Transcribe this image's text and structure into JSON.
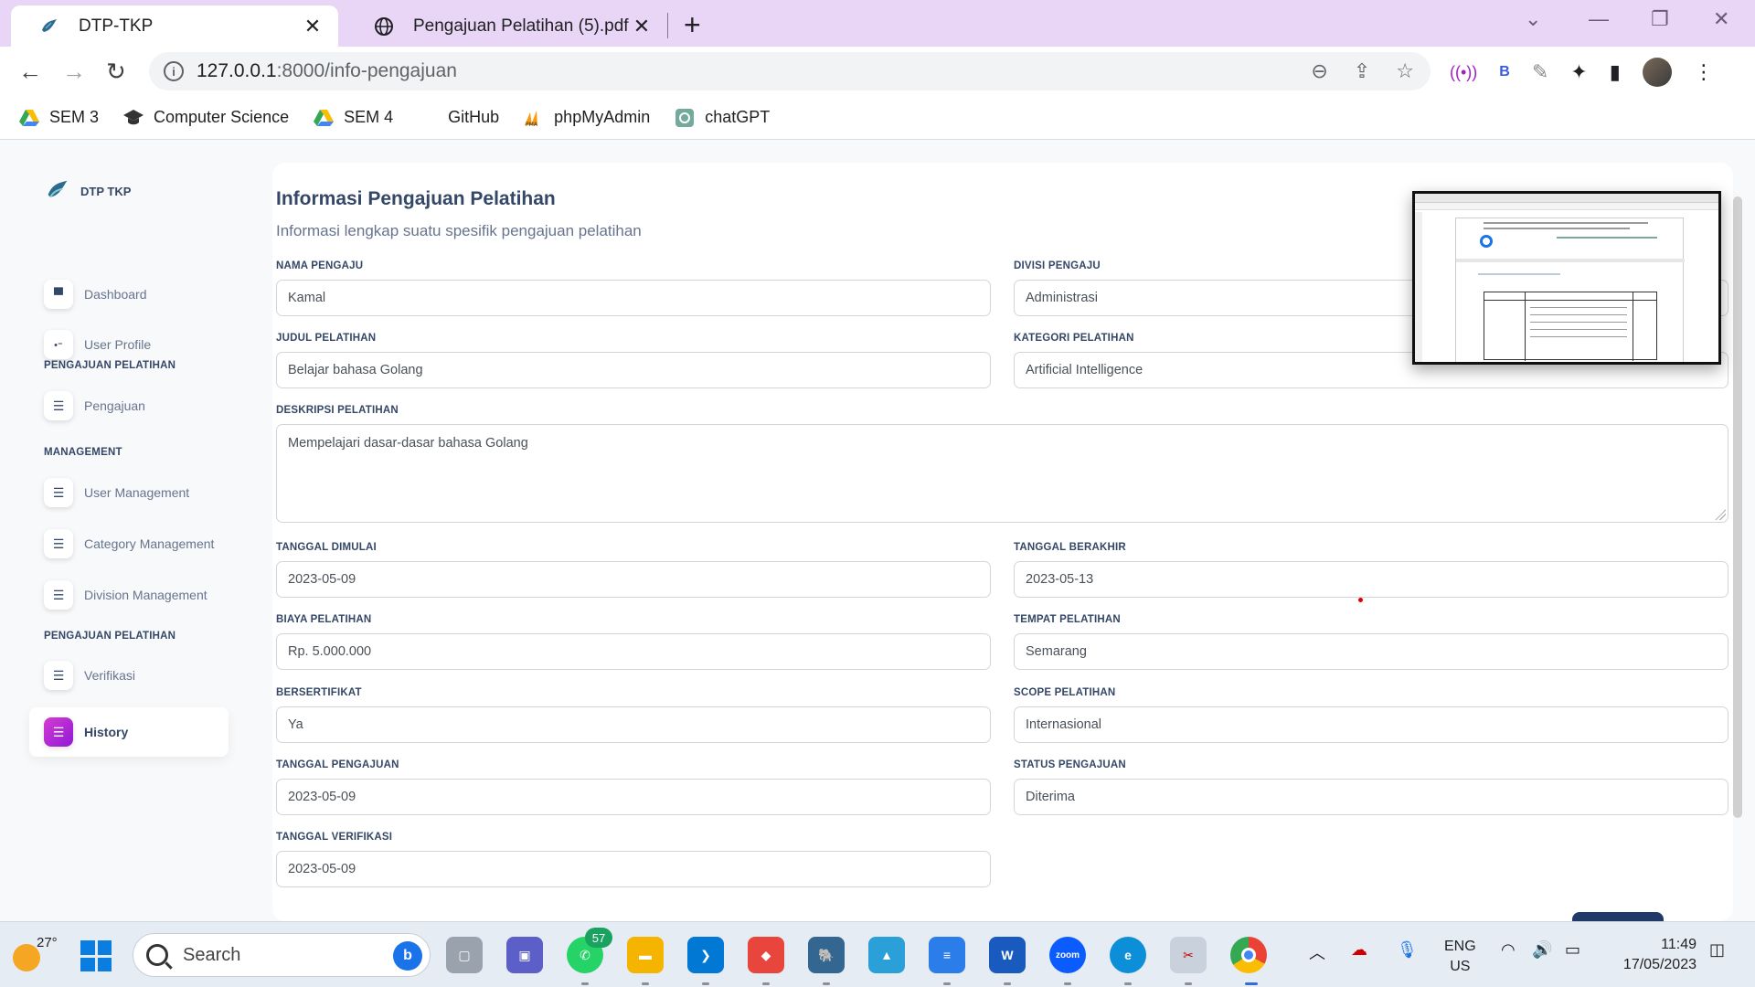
{
  "browser": {
    "tabs": [
      {
        "title": "DTP-TKP",
        "active": true
      },
      {
        "title": "Pengajuan Pelatihan (5).pdf",
        "active": false
      }
    ],
    "url_host": "127.0.0.1",
    "url_path": ":8000/info-pengajuan",
    "bookmarks": [
      {
        "label": "SEM 3",
        "icon": "google-drive-icon"
      },
      {
        "label": "Computer Science",
        "icon": "graduation-cap-icon"
      },
      {
        "label": "SEM 4",
        "icon": "google-drive-icon"
      },
      {
        "label": "GitHub",
        "icon": "github-icon"
      },
      {
        "label": "phpMyAdmin",
        "icon": "phpmyadmin-icon"
      },
      {
        "label": "chatGPT",
        "icon": "chatgpt-icon"
      }
    ]
  },
  "sidebar": {
    "brand": "DTP TKP",
    "items": [
      {
        "label": "Dashboard",
        "icon": "shop-icon"
      },
      {
        "label": "User Profile",
        "icon": "user-icon"
      },
      {
        "label": "Pengajuan",
        "icon": "list-icon"
      },
      {
        "label": "User Management",
        "icon": "list-icon"
      },
      {
        "label": "Category Management",
        "icon": "list-icon"
      },
      {
        "label": "Division Management",
        "icon": "list-icon"
      },
      {
        "label": "Verifikasi",
        "icon": "list-icon"
      },
      {
        "label": "History",
        "icon": "list-icon",
        "active": true
      }
    ],
    "sections": [
      "PENGAJUAN PELATIHAN",
      "MANAGEMENT",
      "PENGAJUAN PELATIHAN"
    ]
  },
  "main": {
    "title": "Informasi Pengajuan Pelatihan",
    "subtitle": "Informasi lengkap suatu spesifik pengajuan pelatihan",
    "fields": {
      "nama_pengaju": {
        "label": "NAMA PENGAJU",
        "value": "Kamal"
      },
      "divisi_pengaju": {
        "label": "DIVISI PENGAJU",
        "value": "Administrasi"
      },
      "judul_pelatihan": {
        "label": "JUDUL PELATIHAN",
        "value": "Belajar bahasa Golang"
      },
      "kategori_pelatihan": {
        "label": "KATEGORI PELATIHAN",
        "value": "Artificial Intelligence"
      },
      "deskripsi_pelatihan": {
        "label": "DESKRIPSI PELATIHAN",
        "value": "Mempelajari dasar-dasar bahasa Golang"
      },
      "tanggal_dimulai": {
        "label": "TANGGAL DIMULAI",
        "value": "2023-05-09"
      },
      "tanggal_berakhir": {
        "label": "TANGGAL BERAKHIR",
        "value": "2023-05-13"
      },
      "biaya_pelatihan": {
        "label": "BIAYA PELATIHAN",
        "value": "Rp. 5.000.000"
      },
      "tempat_pelatihan": {
        "label": "TEMPAT PELATIHAN",
        "value": "Semarang"
      },
      "bersertifikat": {
        "label": "BERSERTIFIKAT",
        "value": "Ya"
      },
      "scope_pelatihan": {
        "label": "SCOPE PELATIHAN",
        "value": "Internasional"
      },
      "tanggal_pengajuan": {
        "label": "TANGGAL PENGAJUAN",
        "value": "2023-05-09"
      },
      "status_pengajuan": {
        "label": "STATUS PENGAJUAN",
        "value": "Diterima"
      },
      "tanggal_verifikasi": {
        "label": "TANGGAL VERIFIKASI",
        "value": "2023-05-09"
      }
    }
  },
  "taskbar": {
    "temperature": "27°",
    "search_placeholder": "Search",
    "whatsapp_badge": "57",
    "lang_line1": "ENG",
    "lang_line2": "US",
    "time": "11:49",
    "date": "17/05/2023"
  },
  "colors": {
    "tabstrip": "#e9d5f5",
    "accent_gradient_start": "#d63bd0",
    "accent_gradient_end": "#8f1ad6",
    "heading": "#344767"
  }
}
